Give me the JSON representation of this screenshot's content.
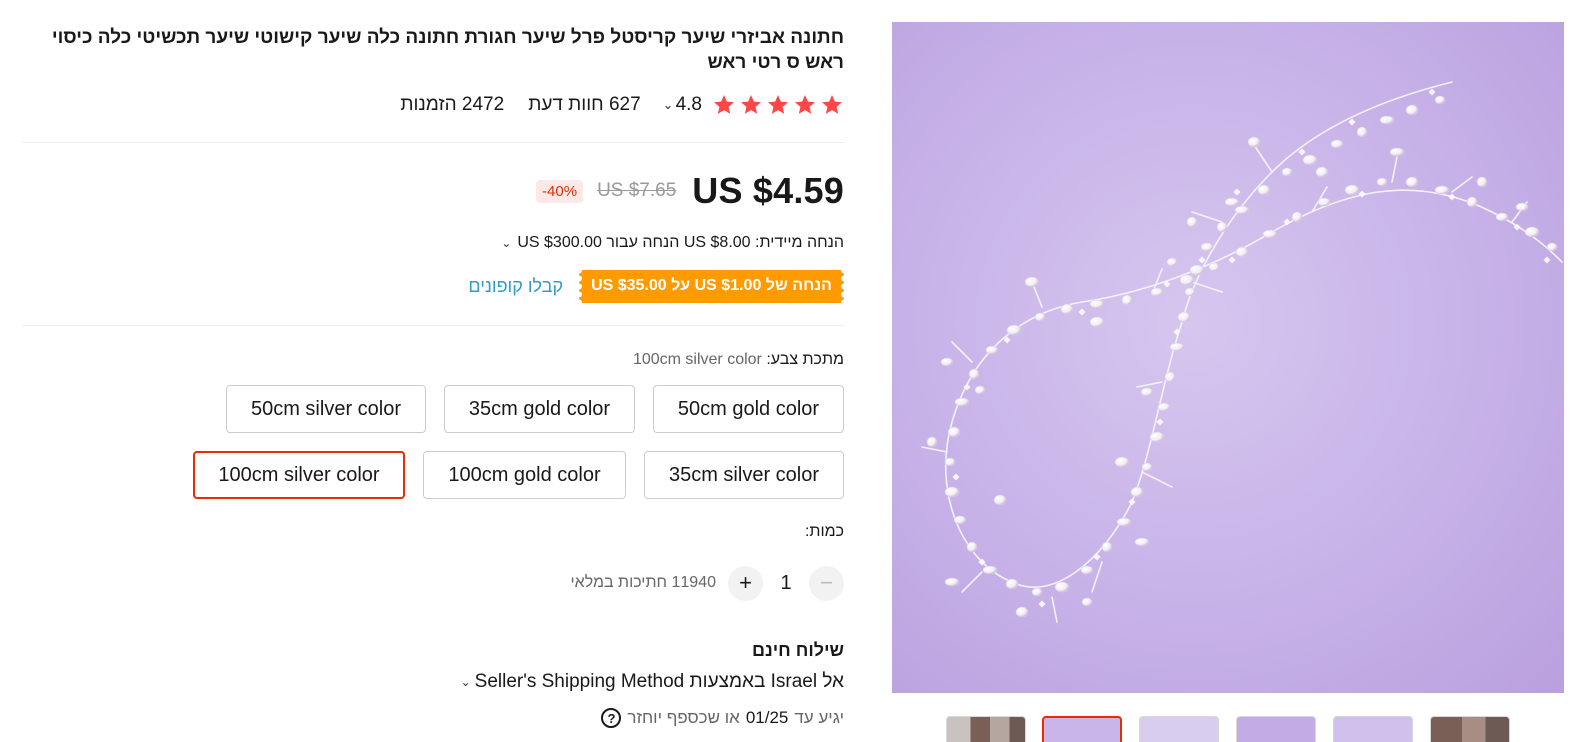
{
  "product": {
    "title": "חתונה אביזרי שיער קריסטל פרל שיער חגורת חתונה כלה שיער קישוטי שיער תכשיטי כלה כיסוי ראש ס רטי ראש",
    "rating": "4.8",
    "rating_stars": 5,
    "reviews": "627 חוות דעת",
    "orders": "2472 הזמנות"
  },
  "price": {
    "current": "US $4.59",
    "original": "US $7.65",
    "discount": "-40%"
  },
  "promo": {
    "instant_discount": "הנחה מיידית: US $8.00 הנחה עבור US $300.00",
    "coupon": "הנחה של US $1.00 על US $35.00",
    "get_coupons": "קבלו קופונים"
  },
  "variants": {
    "label": "מתכת צבע:",
    "selected": "100cm silver color",
    "options": [
      "50cm gold color",
      "35cm gold color",
      "50cm silver color",
      "35cm silver color",
      "100cm gold color",
      "100cm silver color"
    ]
  },
  "quantity": {
    "label": "כמות:",
    "value": "1",
    "minus": "−",
    "plus": "+",
    "stock": "11940 חתיכות במלאי"
  },
  "shipping": {
    "title": "שילוח חינם",
    "destination": "אל Israel באמצעות Seller's Shipping Method",
    "eta": "יגיע עד 01/25 או שכספף יוחזר",
    "eta_prefix": "יגיע עד",
    "eta_date": "01/25",
    "eta_suffix": "או שכספף יוחזר",
    "help_icon": "?"
  },
  "colors": {
    "accent": "#e62e04",
    "star": "#ff4747",
    "coupon_bg": "#ff9a00",
    "link": "#2e9cc4"
  }
}
